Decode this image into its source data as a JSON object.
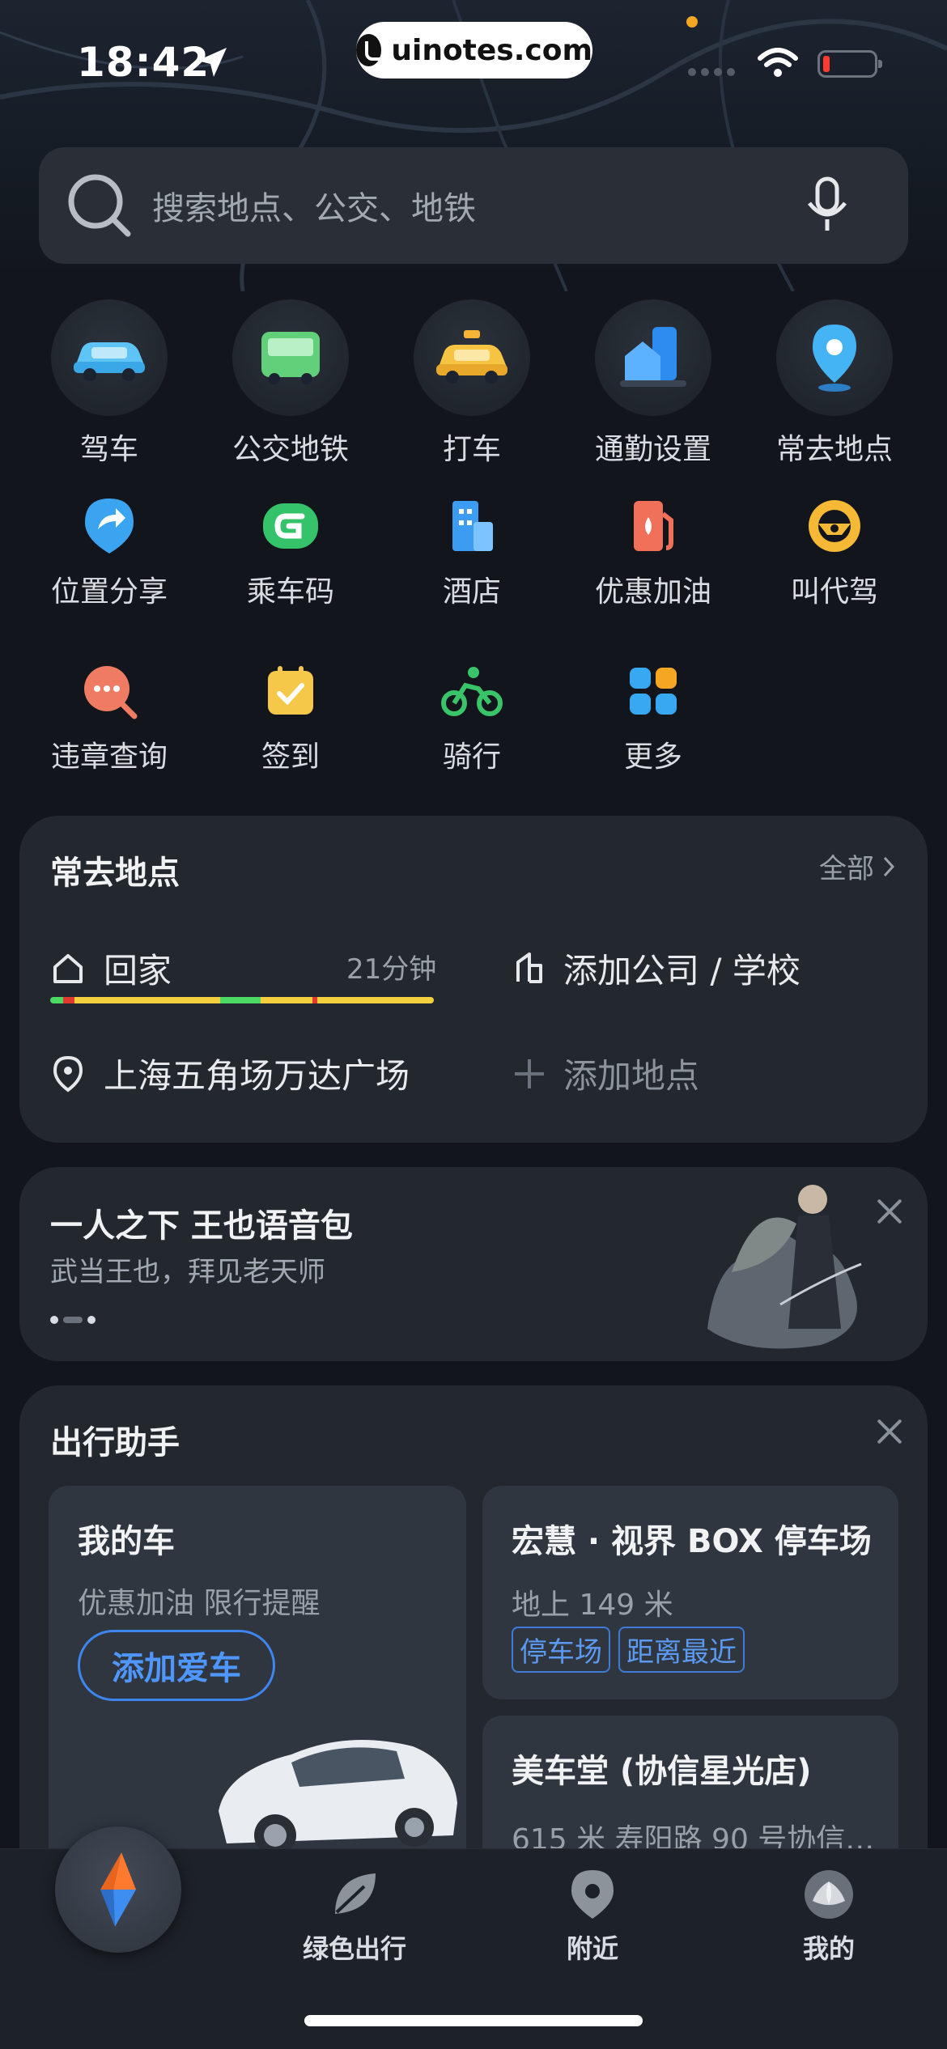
{
  "status_bar": {
    "time": "18:42",
    "watermark": "uinotes.com"
  },
  "search": {
    "placeholder": "搜索地点、公交、地铁"
  },
  "quick_actions": [
    {
      "label": "驾车",
      "icon": "car-icon"
    },
    {
      "label": "公交地铁",
      "icon": "bus-icon"
    },
    {
      "label": "打车",
      "icon": "taxi-icon"
    },
    {
      "label": "通勤设置",
      "icon": "commute-building-icon"
    },
    {
      "label": "常去地点",
      "icon": "location-pin-icon"
    }
  ],
  "services": [
    {
      "label": "位置分享",
      "icon": "share-location-icon"
    },
    {
      "label": "乘车码",
      "icon": "ride-code-icon"
    },
    {
      "label": "酒店",
      "icon": "hotel-icon"
    },
    {
      "label": "优惠加油",
      "icon": "fuel-icon"
    },
    {
      "label": "叫代驾",
      "icon": "steering-wheel-icon"
    },
    {
      "label": "违章查询",
      "icon": "violation-search-icon"
    },
    {
      "label": "签到",
      "icon": "checkin-calendar-icon"
    },
    {
      "label": "骑行",
      "icon": "cycling-icon"
    },
    {
      "label": "更多",
      "icon": "more-grid-icon"
    }
  ],
  "frequent_places": {
    "title": "常去地点",
    "all_label": "全部",
    "home_label": "回家",
    "home_eta": "21分钟",
    "company_label": "添加公司 / 学校",
    "place_label": "上海五角场万达广场",
    "add_place_label": "添加地点"
  },
  "promo": {
    "title": "一人之下  王也语音包",
    "subtitle": "武当王也，拜见老天师"
  },
  "assistant": {
    "title": "出行助手",
    "my_car": {
      "title": "我的车",
      "links": "优惠加油  限行提醒",
      "button": "添加爱车"
    },
    "parking": {
      "title": "宏慧 · 视界 BOX 停车场",
      "distance": "地上  149 米",
      "tags": [
        "停车场",
        "距离最近"
      ]
    },
    "shop": {
      "title": "美车堂 (协信星光店)",
      "address": "615 米  寿阳路 90 号协信…"
    }
  },
  "bottom_nav": [
    {
      "label": "绿色出行",
      "icon": "leaf-icon"
    },
    {
      "label": "附近",
      "icon": "nearby-pin-icon"
    },
    {
      "label": "我的",
      "icon": "profile-lotus-icon"
    }
  ],
  "colors": {
    "background": "#12151b",
    "card": "#23282f",
    "accent_blue": "#3d86ee",
    "traffic_green": "#4cd964",
    "traffic_yellow": "#f4d03f",
    "traffic_red": "#e0392f"
  }
}
